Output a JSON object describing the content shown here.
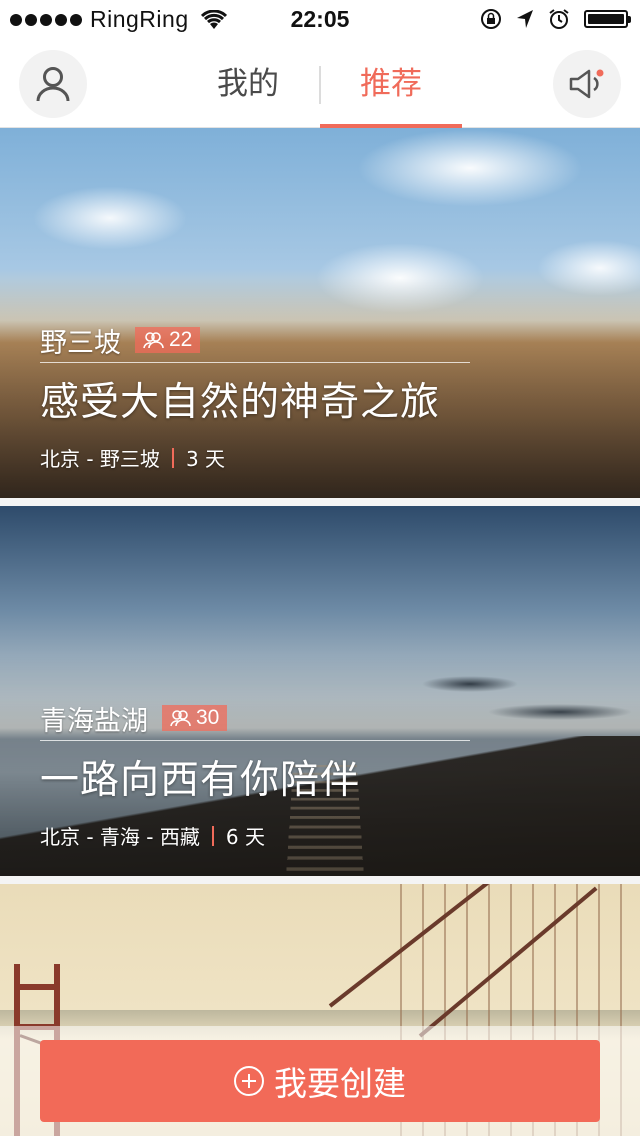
{
  "status_bar": {
    "carrier": "RingRing",
    "time": "22:05",
    "battery_level": 1.0
  },
  "nav": {
    "tabs": [
      {
        "label": "我的",
        "active": false
      },
      {
        "label": "推荐",
        "active": true
      }
    ],
    "accent_color": "#f06b5a"
  },
  "cards": [
    {
      "place": "野三坡",
      "count": "22",
      "title": "感受大自然的神奇之旅",
      "route": "北京 - 野三坡",
      "days": "3 天"
    },
    {
      "place": "青海盐湖",
      "count": "30",
      "title": "一路向西有你陪伴",
      "route": "北京 - 青海 - 西藏",
      "days": "6 天"
    }
  ],
  "create_button": {
    "label": "我要创建",
    "color": "#f26a58"
  },
  "icons": {
    "profile": "user-icon",
    "notification": "speaker-icon",
    "people": "people-icon",
    "add": "plus-circle-icon"
  }
}
